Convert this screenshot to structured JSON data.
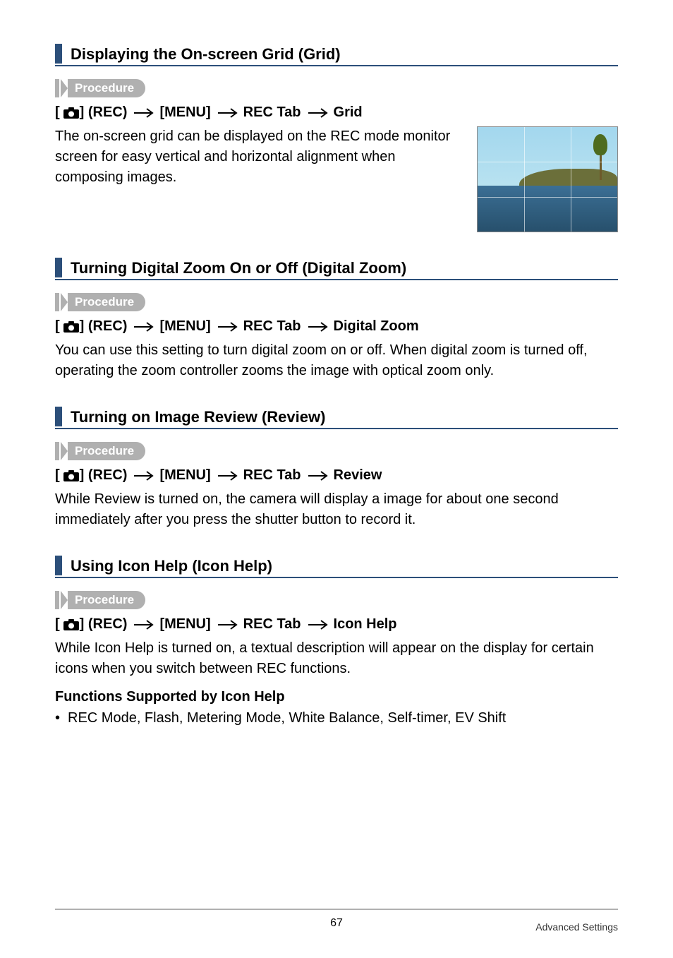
{
  "sections": [
    {
      "title": "Displaying the On-screen Grid (Grid)",
      "procedure_label": "Procedure",
      "path": {
        "rec": "] (REC)",
        "menu": "[MENU]",
        "tab": "REC Tab",
        "item": "Grid"
      },
      "body": "The on-screen grid can be displayed on the REC mode monitor screen for easy vertical and horizontal alignment when composing images.",
      "has_image": true
    },
    {
      "title": "Turning Digital Zoom On or Off (Digital Zoom)",
      "procedure_label": "Procedure",
      "path": {
        "rec": "] (REC)",
        "menu": "[MENU]",
        "tab": "REC Tab",
        "item": "Digital Zoom"
      },
      "body": "You can use this setting to turn digital zoom on or off. When digital zoom is turned off, operating the zoom controller zooms the image with optical zoom only.",
      "has_image": false
    },
    {
      "title": "Turning on Image Review (Review)",
      "procedure_label": "Procedure",
      "path": {
        "rec": "] (REC)",
        "menu": "[MENU]",
        "tab": "REC Tab",
        "item": "Review"
      },
      "body": "While Review is turned on, the camera will display a image for about one second immediately after you press the shutter button to record it.",
      "has_image": false
    },
    {
      "title": "Using Icon Help (Icon Help)",
      "procedure_label": "Procedure",
      "path": {
        "rec": "] (REC)",
        "menu": "[MENU]",
        "tab": "REC Tab",
        "item": "Icon Help"
      },
      "body": "While Icon Help is turned on, a textual description will appear on the display for certain icons when you switch between REC functions.",
      "has_image": false,
      "subhead": "Functions Supported by Icon Help",
      "bullet": "REC Mode, Flash, Metering Mode, White Balance, Self-timer, EV Shift"
    }
  ],
  "footer": {
    "page": "67",
    "right": "Advanced Settings"
  }
}
